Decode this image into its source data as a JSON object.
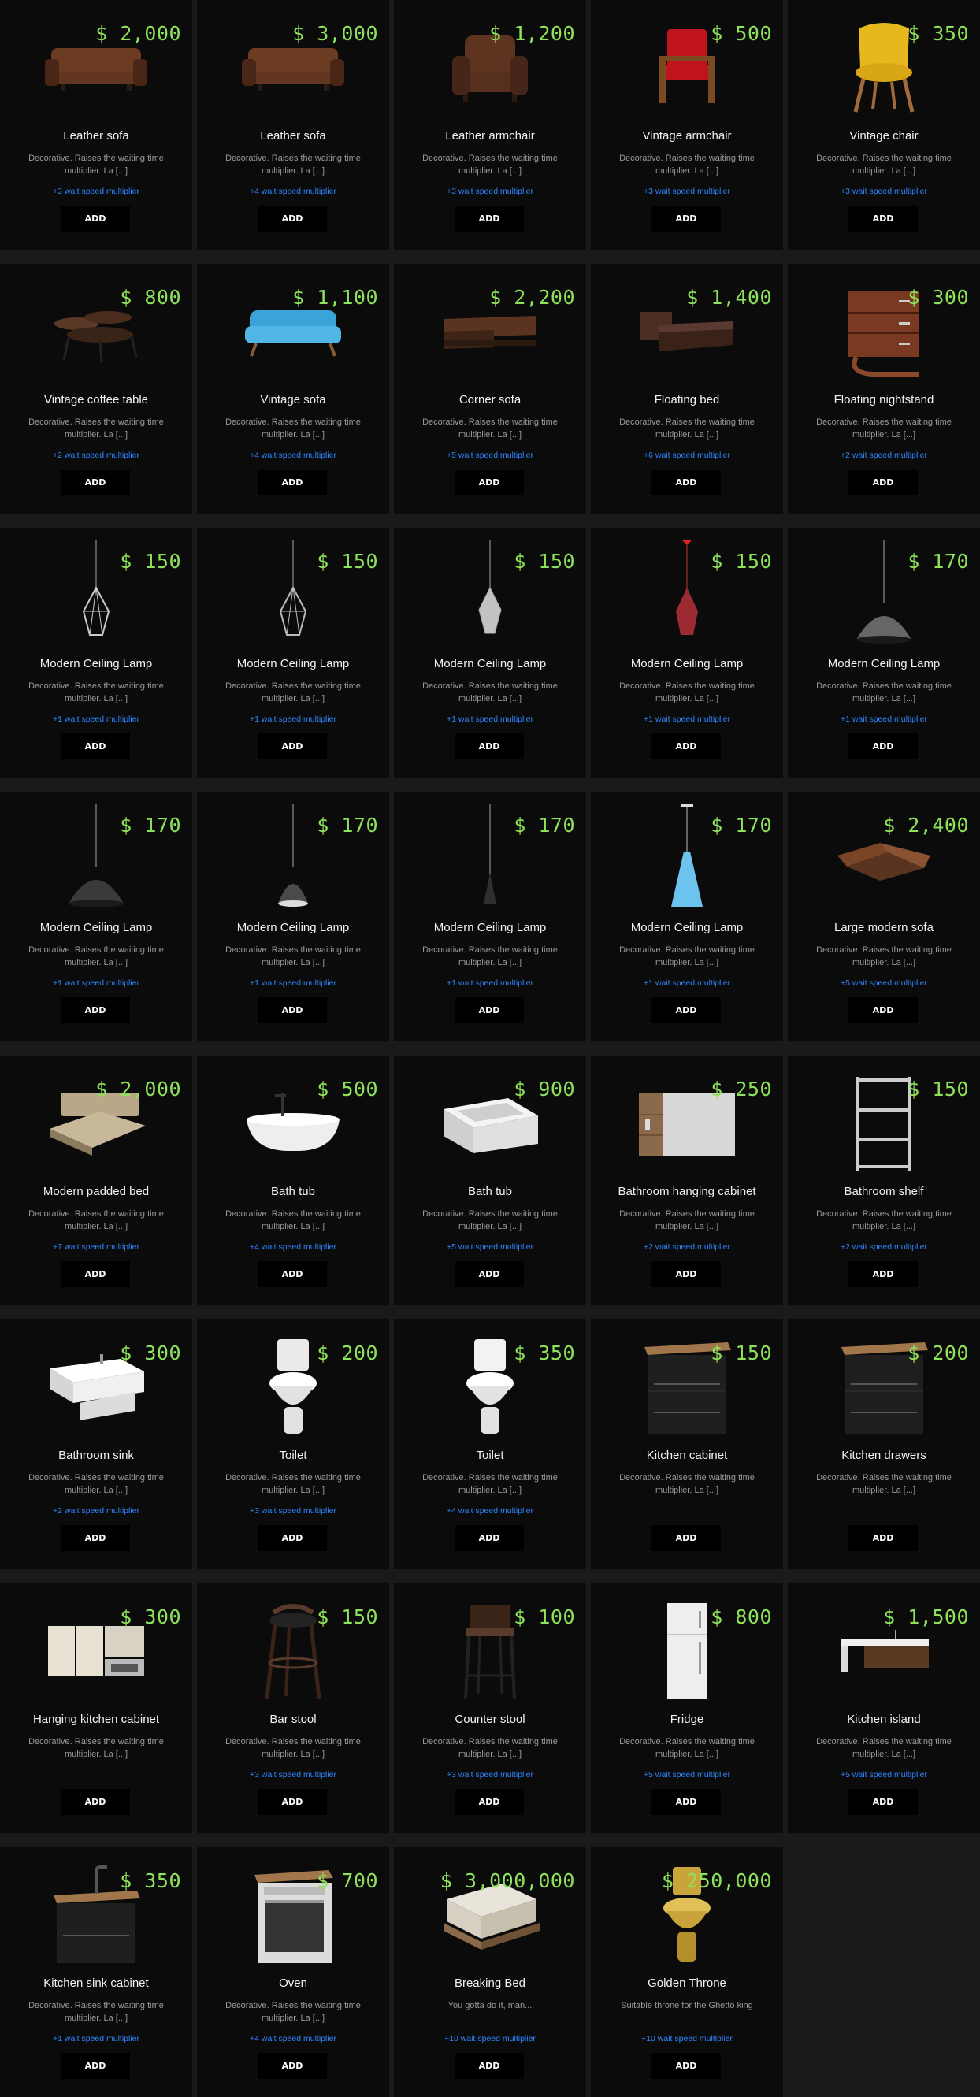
{
  "items": [
    {
      "price": "$ 2,000",
      "name": "Leather sofa",
      "description": "Decorative. Raises the waiting time multiplier. La [...]",
      "multiplier": "+3 wait speed multiplier",
      "add_label": "ADD",
      "icon": "leather-sofa-icon",
      "color": "#6b3b22"
    },
    {
      "price": "$ 3,000",
      "name": "Leather sofa",
      "description": "Decorative. Raises the waiting time multiplier. La [...]",
      "multiplier": "+4 wait speed multiplier",
      "add_label": "ADD",
      "icon": "leather-sofa-icon",
      "color": "#6b3b22"
    },
    {
      "price": "$ 1,200",
      "name": "Leather armchair",
      "description": "Decorative. Raises the waiting time multiplier. La [...]",
      "multiplier": "+3 wait speed multiplier",
      "add_label": "ADD",
      "icon": "leather-armchair-icon",
      "color": "#5e3320"
    },
    {
      "price": "$ 500",
      "name": "Vintage armchair",
      "description": "Decorative. Raises the waiting time multiplier. La [...]",
      "multiplier": "+3 wait speed multiplier",
      "add_label": "ADD",
      "icon": "vintage-armchair-icon",
      "color": "#c0141c"
    },
    {
      "price": "$ 350",
      "name": "Vintage chair",
      "description": "Decorative. Raises the waiting time multiplier. La [...]",
      "multiplier": "+3 wait speed multiplier",
      "add_label": "ADD",
      "icon": "vintage-chair-icon",
      "color": "#e6b81e"
    },
    {
      "price": "$ 800",
      "name": "Vintage coffee table",
      "description": "Decorative. Raises the waiting time multiplier. La [...]",
      "multiplier": "+2 wait speed multiplier",
      "add_label": "ADD",
      "icon": "coffee-table-icon",
      "color": "#4a2c1c"
    },
    {
      "price": "$ 1,100",
      "name": "Vintage sofa",
      "description": "Decorative. Raises the waiting time multiplier. La [...]",
      "multiplier": "+4 wait speed multiplier",
      "add_label": "ADD",
      "icon": "vintage-sofa-icon",
      "color": "#3aa3d8"
    },
    {
      "price": "$ 2,200",
      "name": "Corner sofa",
      "description": "Decorative. Raises the waiting time multiplier. La [...]",
      "multiplier": "+5 wait speed multiplier",
      "add_label": "ADD",
      "icon": "corner-sofa-icon",
      "color": "#5a3420"
    },
    {
      "price": "$ 1,400",
      "name": "Floating bed",
      "description": "Decorative. Raises the waiting time multiplier. La [...]",
      "multiplier": "+6 wait speed multiplier",
      "add_label": "ADD",
      "icon": "floating-bed-icon",
      "color": "#5a3a30"
    },
    {
      "price": "$ 300",
      "name": "Floating nightstand",
      "description": "Decorative. Raises the waiting time multiplier. La [...]",
      "multiplier": "+2 wait speed multiplier",
      "add_label": "ADD",
      "icon": "nightstand-icon",
      "color": "#7a3a22"
    },
    {
      "price": "$ 150",
      "name": "Modern Ceiling Lamp",
      "description": "Decorative. Raises the waiting time multiplier. La [...]",
      "multiplier": "+1 wait speed multiplier",
      "add_label": "ADD",
      "icon": "wire-cage-lamp-icon",
      "color": "#cccccc"
    },
    {
      "price": "$ 150",
      "name": "Modern Ceiling Lamp",
      "description": "Decorative. Raises the waiting time multiplier. La [...]",
      "multiplier": "+1 wait speed multiplier",
      "add_label": "ADD",
      "icon": "wire-cage-lamp-icon",
      "color": "#bbbbbb"
    },
    {
      "price": "$ 150",
      "name": "Modern Ceiling Lamp",
      "description": "Decorative. Raises the waiting time multiplier. La [...]",
      "multiplier": "+1 wait speed multiplier",
      "add_label": "ADD",
      "icon": "crystal-lamp-icon",
      "color": "#dddddd"
    },
    {
      "price": "$ 150",
      "name": "Modern Ceiling Lamp",
      "description": "Decorative. Raises the waiting time multiplier. La [...]",
      "multiplier": "+1 wait speed multiplier",
      "add_label": "ADD",
      "icon": "red-glass-lamp-icon",
      "color": "#b5303a"
    },
    {
      "price": "$ 170",
      "name": "Modern Ceiling Lamp",
      "description": "Decorative. Raises the waiting time multiplier. La [...]",
      "multiplier": "+1 wait speed multiplier",
      "add_label": "ADD",
      "icon": "dome-lamp-icon",
      "color": "#666666"
    },
    {
      "price": "$ 170",
      "name": "Modern Ceiling Lamp",
      "description": "Decorative. Raises the waiting time multiplier. La [...]",
      "multiplier": "+1 wait speed multiplier",
      "add_label": "ADD",
      "icon": "dome-lamp-icon",
      "color": "#3a3a3a"
    },
    {
      "price": "$ 170",
      "name": "Modern Ceiling Lamp",
      "description": "Decorative. Raises the waiting time multiplier. La [...]",
      "multiplier": "+1 wait speed multiplier",
      "add_label": "ADD",
      "icon": "half-dome-lamp-icon",
      "color": "#4a4a4a"
    },
    {
      "price": "$ 170",
      "name": "Modern Ceiling Lamp",
      "description": "Decorative. Raises the waiting time multiplier. La [...]",
      "multiplier": "+1 wait speed multiplier",
      "add_label": "ADD",
      "icon": "cone-lamp-icon",
      "color": "#2f2f2f"
    },
    {
      "price": "$ 170",
      "name": "Modern Ceiling Lamp",
      "description": "Decorative. Raises the waiting time multiplier. La [...]",
      "multiplier": "+1 wait speed multiplier",
      "add_label": "ADD",
      "icon": "flare-lamp-icon",
      "color": "#6cc4ee"
    },
    {
      "price": "$ 2,400",
      "name": "Large modern sofa",
      "description": "Decorative. Raises the waiting time multiplier. La [...]",
      "multiplier": "+5 wait speed multiplier",
      "add_label": "ADD",
      "icon": "large-sofa-icon",
      "color": "#7a4526"
    },
    {
      "price": "$ 2,000",
      "name": "Modern padded bed",
      "description": "Decorative. Raises the waiting time multiplier. La [...]",
      "multiplier": "+7 wait speed multiplier",
      "add_label": "ADD",
      "icon": "padded-bed-icon",
      "color": "#c8b89a"
    },
    {
      "price": "$ 500",
      "name": "Bath tub",
      "description": "Decorative. Raises the waiting time multiplier. La [...]",
      "multiplier": "+4 wait speed multiplier",
      "add_label": "ADD",
      "icon": "bathtub-icon",
      "color": "#eeeeee"
    },
    {
      "price": "$ 900",
      "name": "Bath tub",
      "description": "Decorative. Raises the waiting time multiplier. La [...]",
      "multiplier": "+5 wait speed multiplier",
      "add_label": "ADD",
      "icon": "built-in-bathtub-icon",
      "color": "#e0e0e0"
    },
    {
      "price": "$ 250",
      "name": "Bathroom hanging cabinet",
      "description": "Decorative. Raises the waiting time multiplier. La [...]",
      "multiplier": "+2 wait speed multiplier",
      "add_label": "ADD",
      "icon": "hanging-cabinet-icon",
      "color": "#d8d8d8"
    },
    {
      "price": "$ 150",
      "name": "Bathroom shelf",
      "description": "Decorative. Raises the waiting time multiplier. La [...]",
      "multiplier": "+2 wait speed multiplier",
      "add_label": "ADD",
      "icon": "shelf-icon",
      "color": "#cccccc"
    },
    {
      "price": "$ 300",
      "name": "Bathroom sink",
      "description": "Decorative. Raises the waiting time multiplier. La [...]",
      "multiplier": "+2 wait speed multiplier",
      "add_label": "ADD",
      "icon": "sink-icon",
      "color": "#f0f0f0"
    },
    {
      "price": "$ 200",
      "name": "Toilet",
      "description": "Decorative. Raises the waiting time multiplier. La [...]",
      "multiplier": "+3 wait speed multiplier",
      "add_label": "ADD",
      "icon": "toilet-icon",
      "color": "#eaeaea"
    },
    {
      "price": "$ 350",
      "name": "Toilet",
      "description": "Decorative. Raises the waiting time multiplier. La [...]",
      "multiplier": "+4 wait speed multiplier",
      "add_label": "ADD",
      "icon": "toilet-icon",
      "color": "#f2f2f2"
    },
    {
      "price": "$ 150",
      "name": "Kitchen cabinet",
      "description": "Decorative. Raises the waiting time multiplier. La [...]",
      "multiplier": "",
      "add_label": "ADD",
      "icon": "kitchen-cabinet-icon",
      "color": "#1f1f1f"
    },
    {
      "price": "$ 200",
      "name": "Kitchen drawers",
      "description": "Decorative. Raises the waiting time multiplier. La [...]",
      "multiplier": "",
      "add_label": "ADD",
      "icon": "kitchen-drawers-icon",
      "color": "#1f1f1f"
    },
    {
      "price": "$ 300",
      "name": "Hanging kitchen cabinet",
      "description": "Decorative. Raises the waiting time multiplier. La [...]",
      "multiplier": "",
      "add_label": "ADD",
      "icon": "wall-cabinet-icon",
      "color": "#e8e2d4"
    },
    {
      "price": "$ 150",
      "name": "Bar stool",
      "description": "Decorative. Raises the waiting time multiplier. La [...]",
      "multiplier": "+3 wait speed multiplier",
      "add_label": "ADD",
      "icon": "bar-stool-icon",
      "color": "#3a2218"
    },
    {
      "price": "$ 100",
      "name": "Counter stool",
      "description": "Decorative. Raises the waiting time multiplier. La [...]",
      "multiplier": "+3 wait speed multiplier",
      "add_label": "ADD",
      "icon": "counter-stool-icon",
      "color": "#2a1c14"
    },
    {
      "price": "$ 800",
      "name": "Fridge",
      "description": "Decorative. Raises the waiting time multiplier. La [...]",
      "multiplier": "+5 wait speed multiplier",
      "add_label": "ADD",
      "icon": "fridge-icon",
      "color": "#eeeeee"
    },
    {
      "price": "$ 1,500",
      "name": "Kitchen island",
      "description": "Decorative. Raises the waiting time multiplier. La [...]",
      "multiplier": "+5 wait speed multiplier",
      "add_label": "ADD",
      "icon": "kitchen-island-icon",
      "color": "#f0f0f0"
    },
    {
      "price": "$ 350",
      "name": "Kitchen sink cabinet",
      "description": "Decorative. Raises the waiting time multiplier. La [...]",
      "multiplier": "+1 wait speed multiplier",
      "add_label": "ADD",
      "icon": "sink-cabinet-icon",
      "color": "#1f1f1f"
    },
    {
      "price": "$ 700",
      "name": "Oven",
      "description": "Decorative. Raises the waiting time multiplier. La [...]",
      "multiplier": "+4 wait speed multiplier",
      "add_label": "ADD",
      "icon": "oven-icon",
      "color": "#dcdcdc"
    },
    {
      "price": "$ 3,000,000",
      "name": "Breaking Bed",
      "description": "You gotta do it, man...",
      "multiplier": "+10 wait speed multiplier",
      "add_label": "ADD",
      "icon": "money-pallet-icon",
      "color": "#e8e4da"
    },
    {
      "price": "$ 250,000",
      "name": "Golden Throne",
      "description": "Suitable throne for the Ghetto king",
      "multiplier": "+10 wait speed multiplier",
      "add_label": "ADD",
      "icon": "golden-toilet-icon",
      "color": "#c9a43a"
    }
  ]
}
